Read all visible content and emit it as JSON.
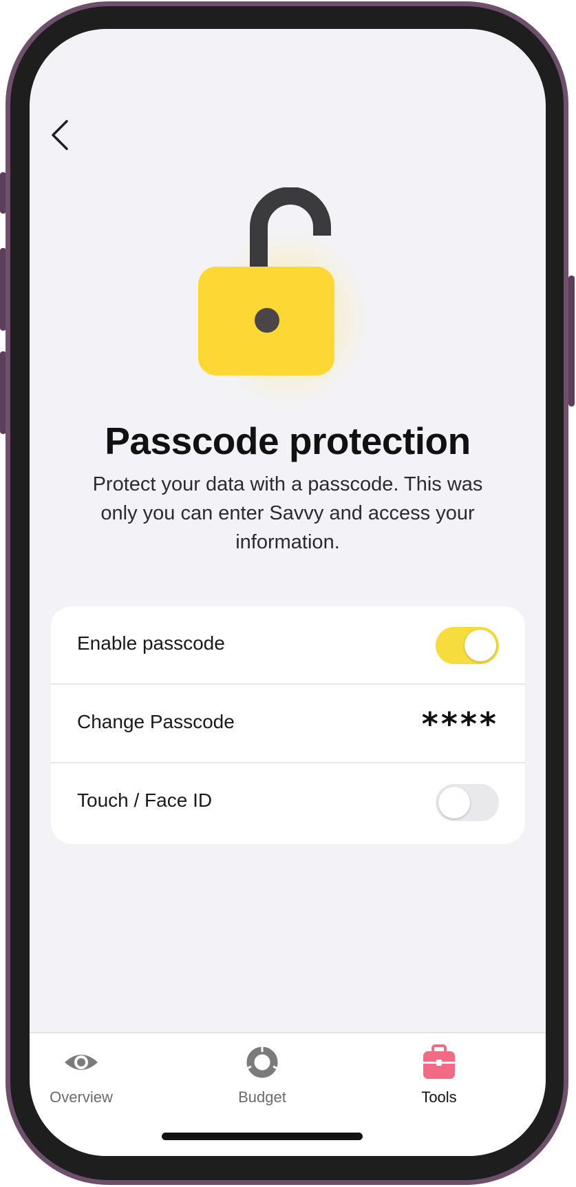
{
  "screen": {
    "title": "Passcode protection",
    "subtitle": "Protect your data with a passcode. This was only you can enter Savvy and access your information."
  },
  "settings": [
    {
      "label": "Enable passcode",
      "control": "toggle",
      "state": "on"
    },
    {
      "label": "Change Passcode",
      "control": "value",
      "value": "****"
    },
    {
      "label": "Touch / Face ID",
      "control": "toggle",
      "state": "off"
    }
  ],
  "tabbar": {
    "tabs": [
      {
        "label": "Overview",
        "icon": "eye-icon",
        "active": false
      },
      {
        "label": "Budget",
        "icon": "donut-chart-icon",
        "active": false
      },
      {
        "label": "Tools",
        "icon": "toolbox-icon",
        "active": true
      }
    ]
  },
  "colors": {
    "accent_yellow": "#f7dc3e",
    "lock_body": "#fdd835",
    "tools_pink": "#f26b84",
    "frame_purple": "#6e4f6c"
  },
  "icons": {
    "back": "chevron-left-icon",
    "hero": "unlocked-padlock-icon"
  }
}
